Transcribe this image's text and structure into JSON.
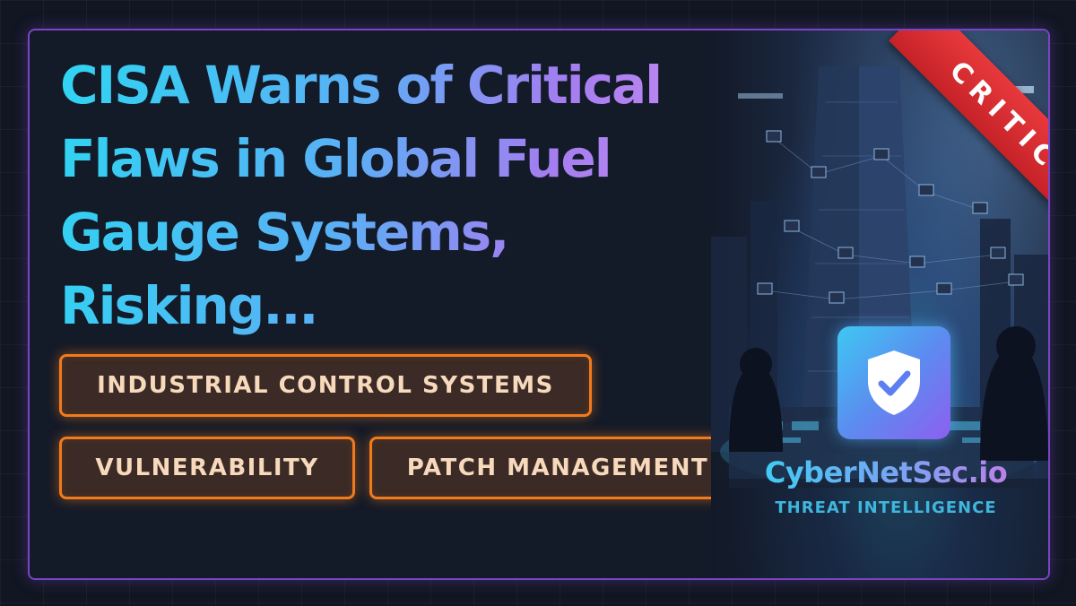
{
  "headline": "CISA Warns of Critical Flaws in Global Fuel Gauge Systems, Risking...",
  "tags": [
    "INDUSTRIAL CONTROL SYSTEMS",
    "VULNERABILITY",
    "PATCH MANAGEMENT"
  ],
  "ribbon": {
    "label": "CRITICAL",
    "color": "#d72b2f"
  },
  "brand": {
    "name": "CyberNetSec.io",
    "tagline": "THREAT INTELLIGENCE",
    "icon": "shield-check-icon"
  },
  "colors": {
    "frame": "#7a45c4",
    "tag_border": "#f17a1d",
    "accent_cyan": "#2fd4f2",
    "accent_purple": "#a47df0"
  }
}
